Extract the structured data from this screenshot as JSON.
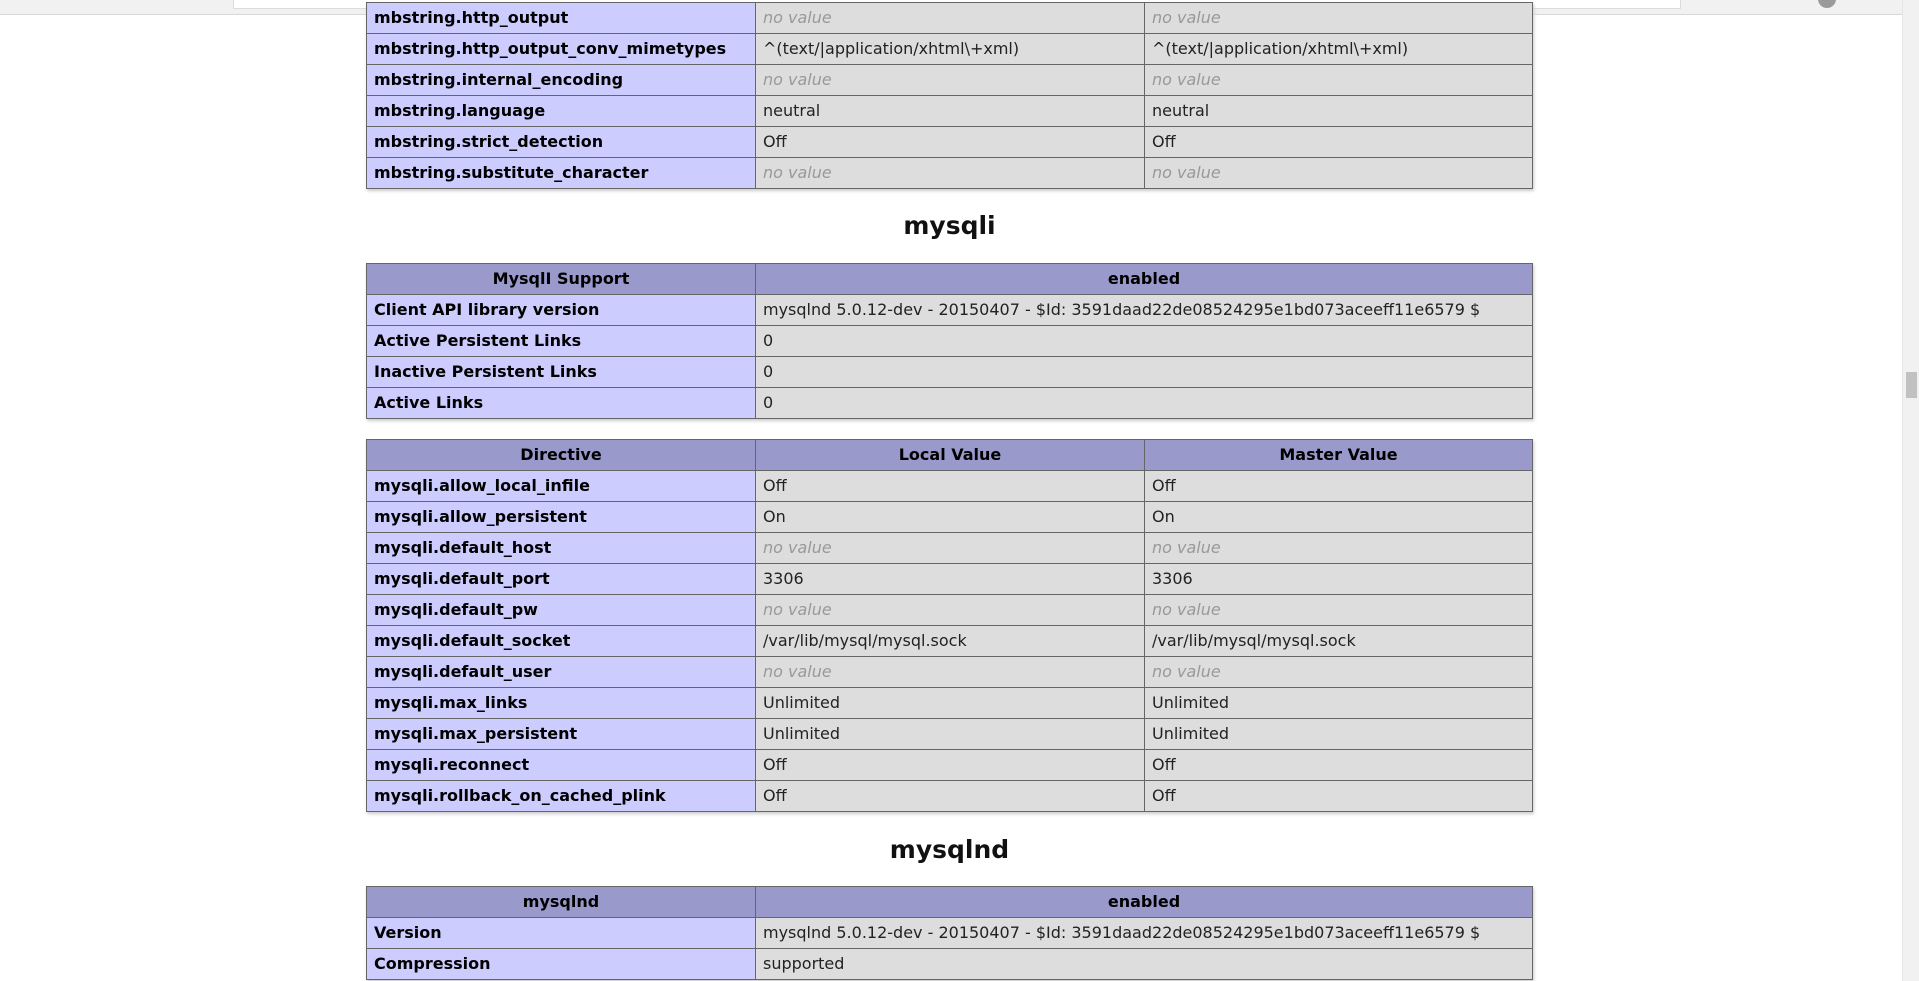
{
  "mbstring": {
    "rows": [
      {
        "name": "mbstring.http_output",
        "local": "no value",
        "master": "no value",
        "novalue": true
      },
      {
        "name": "mbstring.http_output_conv_mimetypes",
        "local": "^(text/|application/xhtml\\+xml)",
        "master": "^(text/|application/xhtml\\+xml)",
        "novalue": false
      },
      {
        "name": "mbstring.internal_encoding",
        "local": "no value",
        "master": "no value",
        "novalue": true
      },
      {
        "name": "mbstring.language",
        "local": "neutral",
        "master": "neutral",
        "novalue": false
      },
      {
        "name": "mbstring.strict_detection",
        "local": "Off",
        "master": "Off",
        "novalue": false
      },
      {
        "name": "mbstring.substitute_character",
        "local": "no value",
        "master": "no value",
        "novalue": true
      }
    ]
  },
  "mysqli": {
    "title": "mysqli",
    "support": {
      "header_left": "MysqlI Support",
      "header_right": "enabled",
      "rows": [
        {
          "name": "Client API library version",
          "value": "mysqlnd 5.0.12-dev - 20150407 - $Id: 3591daad22de08524295e1bd073aceeff11e6579 $"
        },
        {
          "name": "Active Persistent Links",
          "value": "0"
        },
        {
          "name": "Inactive Persistent Links",
          "value": "0"
        },
        {
          "name": "Active Links",
          "value": "0"
        }
      ]
    },
    "directives": {
      "headers": [
        "Directive",
        "Local Value",
        "Master Value"
      ],
      "rows": [
        {
          "name": "mysqli.allow_local_infile",
          "local": "Off",
          "master": "Off",
          "novalue": false
        },
        {
          "name": "mysqli.allow_persistent",
          "local": "On",
          "master": "On",
          "novalue": false
        },
        {
          "name": "mysqli.default_host",
          "local": "no value",
          "master": "no value",
          "novalue": true
        },
        {
          "name": "mysqli.default_port",
          "local": "3306",
          "master": "3306",
          "novalue": false
        },
        {
          "name": "mysqli.default_pw",
          "local": "no value",
          "master": "no value",
          "novalue": true
        },
        {
          "name": "mysqli.default_socket",
          "local": "/var/lib/mysql/mysql.sock",
          "master": "/var/lib/mysql/mysql.sock",
          "novalue": false
        },
        {
          "name": "mysqli.default_user",
          "local": "no value",
          "master": "no value",
          "novalue": true
        },
        {
          "name": "mysqli.max_links",
          "local": "Unlimited",
          "master": "Unlimited",
          "novalue": false
        },
        {
          "name": "mysqli.max_persistent",
          "local": "Unlimited",
          "master": "Unlimited",
          "novalue": false
        },
        {
          "name": "mysqli.reconnect",
          "local": "Off",
          "master": "Off",
          "novalue": false
        },
        {
          "name": "mysqli.rollback_on_cached_plink",
          "local": "Off",
          "master": "Off",
          "novalue": false
        }
      ]
    }
  },
  "mysqlnd": {
    "title": "mysqlnd",
    "header_left": "mysqlnd",
    "header_right": "enabled",
    "rows": [
      {
        "name": "Version",
        "value": "mysqlnd 5.0.12-dev - 20150407 - $Id: 3591daad22de08524295e1bd073aceeff11e6579 $"
      },
      {
        "name": "Compression",
        "value": "supported"
      }
    ]
  }
}
